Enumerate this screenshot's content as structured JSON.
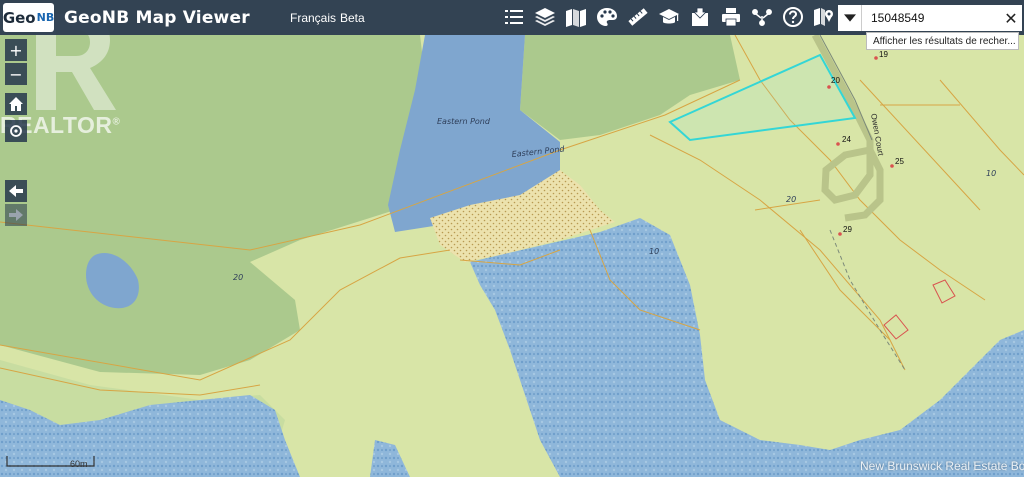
{
  "header": {
    "logo_text": "Geo",
    "logo_suffix": "NB",
    "app_title": "GeoNB Map Viewer",
    "language_link": "Français",
    "beta_link": "Beta"
  },
  "toolbar": {
    "tools": [
      {
        "name": "list-icon"
      },
      {
        "name": "layers-icon"
      },
      {
        "name": "basemap-icon"
      },
      {
        "name": "palette-icon"
      },
      {
        "name": "measure-icon"
      },
      {
        "name": "education-icon"
      },
      {
        "name": "download-icon"
      },
      {
        "name": "print-icon"
      },
      {
        "name": "share-icon"
      },
      {
        "name": "help-icon"
      },
      {
        "name": "directions-icon"
      }
    ]
  },
  "search": {
    "value": "15048549",
    "clear_symbol": "✕",
    "suggestion": "Afficher les résultats de recher..."
  },
  "map_controls": {
    "zoom_in": "+",
    "zoom_out": "−",
    "home": "home-icon",
    "locate": "locate-icon",
    "back": "arrow-left-icon",
    "forward": "arrow-right-icon"
  },
  "map": {
    "water_labels": [
      "Eastern Pond",
      "Eastern Pond"
    ],
    "lot_labels": [
      "19",
      "20",
      "24",
      "25",
      "29"
    ],
    "road_label": "Owen Court",
    "contour_labels": [
      "20",
      "20",
      "10",
      "10"
    ],
    "colors": {
      "land": "#d9e6a6",
      "forest": "#a8c68a",
      "water": "#7fa6cf",
      "marsh": "#e3d49a",
      "selected_parcel": "#33d6d6",
      "parcel_line": "#d9a441"
    }
  },
  "watermarks": {
    "realtor": "REALTOR",
    "realtor_mark": "®",
    "scale": "60m",
    "board": "New Brunswick Real Estate Board"
  }
}
